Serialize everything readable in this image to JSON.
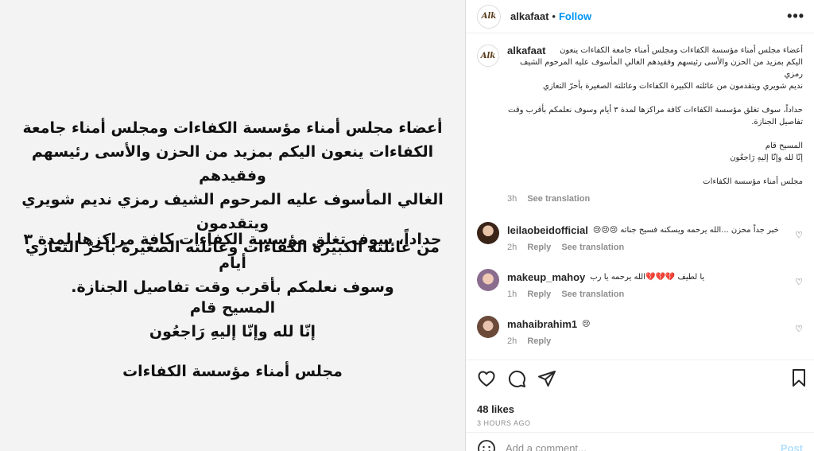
{
  "post": {
    "image_text": {
      "p1": [
        "أعضاء مجلس أمناء مؤسسة الكفاءات ومجلس أمناء جامعة",
        "الكفاءات ينعون اليكم بمزيد من الحزن والأسى رئيسهم وفقيدهم",
        "الغالي المأسوف عليه المرحوم الشيف رمزي نديم شويري ويتقدمون",
        "من عائلته الكبيرة الكفاءات وعائلته الصغيرة بأحرّ التعازي"
      ],
      "p2": [
        "حداداً، سوف تغلق مؤسسة الكفاءات كافة مراكزها لمدة ٣ أيام",
        "وسوف نعلمكم بأقرب وقت تفاصيل الجنازة."
      ],
      "p3": [
        "المسيح قام",
        "إنّا لله وإنّا إليهِ رَاجعُون"
      ],
      "p4": "مجلس أمناء مؤسسة الكفاءات"
    }
  },
  "header": {
    "username": "alkafaat",
    "dot": "•",
    "follow_label": "Follow",
    "more": "•••",
    "logo_text": "Alk"
  },
  "caption": {
    "username": "alkafaat",
    "line1": "أعضاء مجلس أمناء مؤسسة الكفاءات ومجلس أمناء جامعة الكفاءات ينعون",
    "line2": "اليكم بمزيد من الحزن والأسى رئيسهم وفقيدهم الغالي المأسوف عليه المرحوم الشيف رمزي",
    "line3": "نديم شويري ويتقدمون من عائلته الكبيرة الكفاءات وعائلته الصغيرة بأحرّ التعازي",
    "para2a": "حداداً، سوف تغلق مؤسسة الكفاءات كافة مراكزها لمدة ٣ أيام وسوف نعلمكم بأقرب وقت",
    "para2b": "تفاصيل الجنازة.",
    "para3a": "المسيح قام",
    "para3b": "إنّا لله وإنّا إليهِ رَاجعُون",
    "para4": "مجلس أمناء مؤسسة الكفاءات",
    "time": "3h",
    "see_translation": "See translation"
  },
  "comments": [
    {
      "username": "leilaobeidofficial",
      "text": "خبر جداً محزن ...الله يرحمه ويسكنه فسيح جناته 😢😢😢",
      "time": "2h",
      "reply": "Reply",
      "see_translation": "See translation"
    },
    {
      "username": "makeup_mahoy",
      "text": "يا لطيف 💔💔💔الله يرحمه يا رب",
      "time": "1h",
      "reply": "Reply",
      "see_translation": "See translation"
    },
    {
      "username": "mahaibrahim1",
      "text": "😢",
      "time": "2h",
      "reply": "Reply"
    }
  ],
  "actions": {
    "likes": "48 likes",
    "posted": "3 HOURS AGO"
  },
  "add_comment": {
    "placeholder": "Add a comment...",
    "post_label": "Post"
  },
  "colors": {
    "accent": "#0095f6",
    "muted": "#8e8e8e",
    "post_disabled": "#b2dffc"
  }
}
